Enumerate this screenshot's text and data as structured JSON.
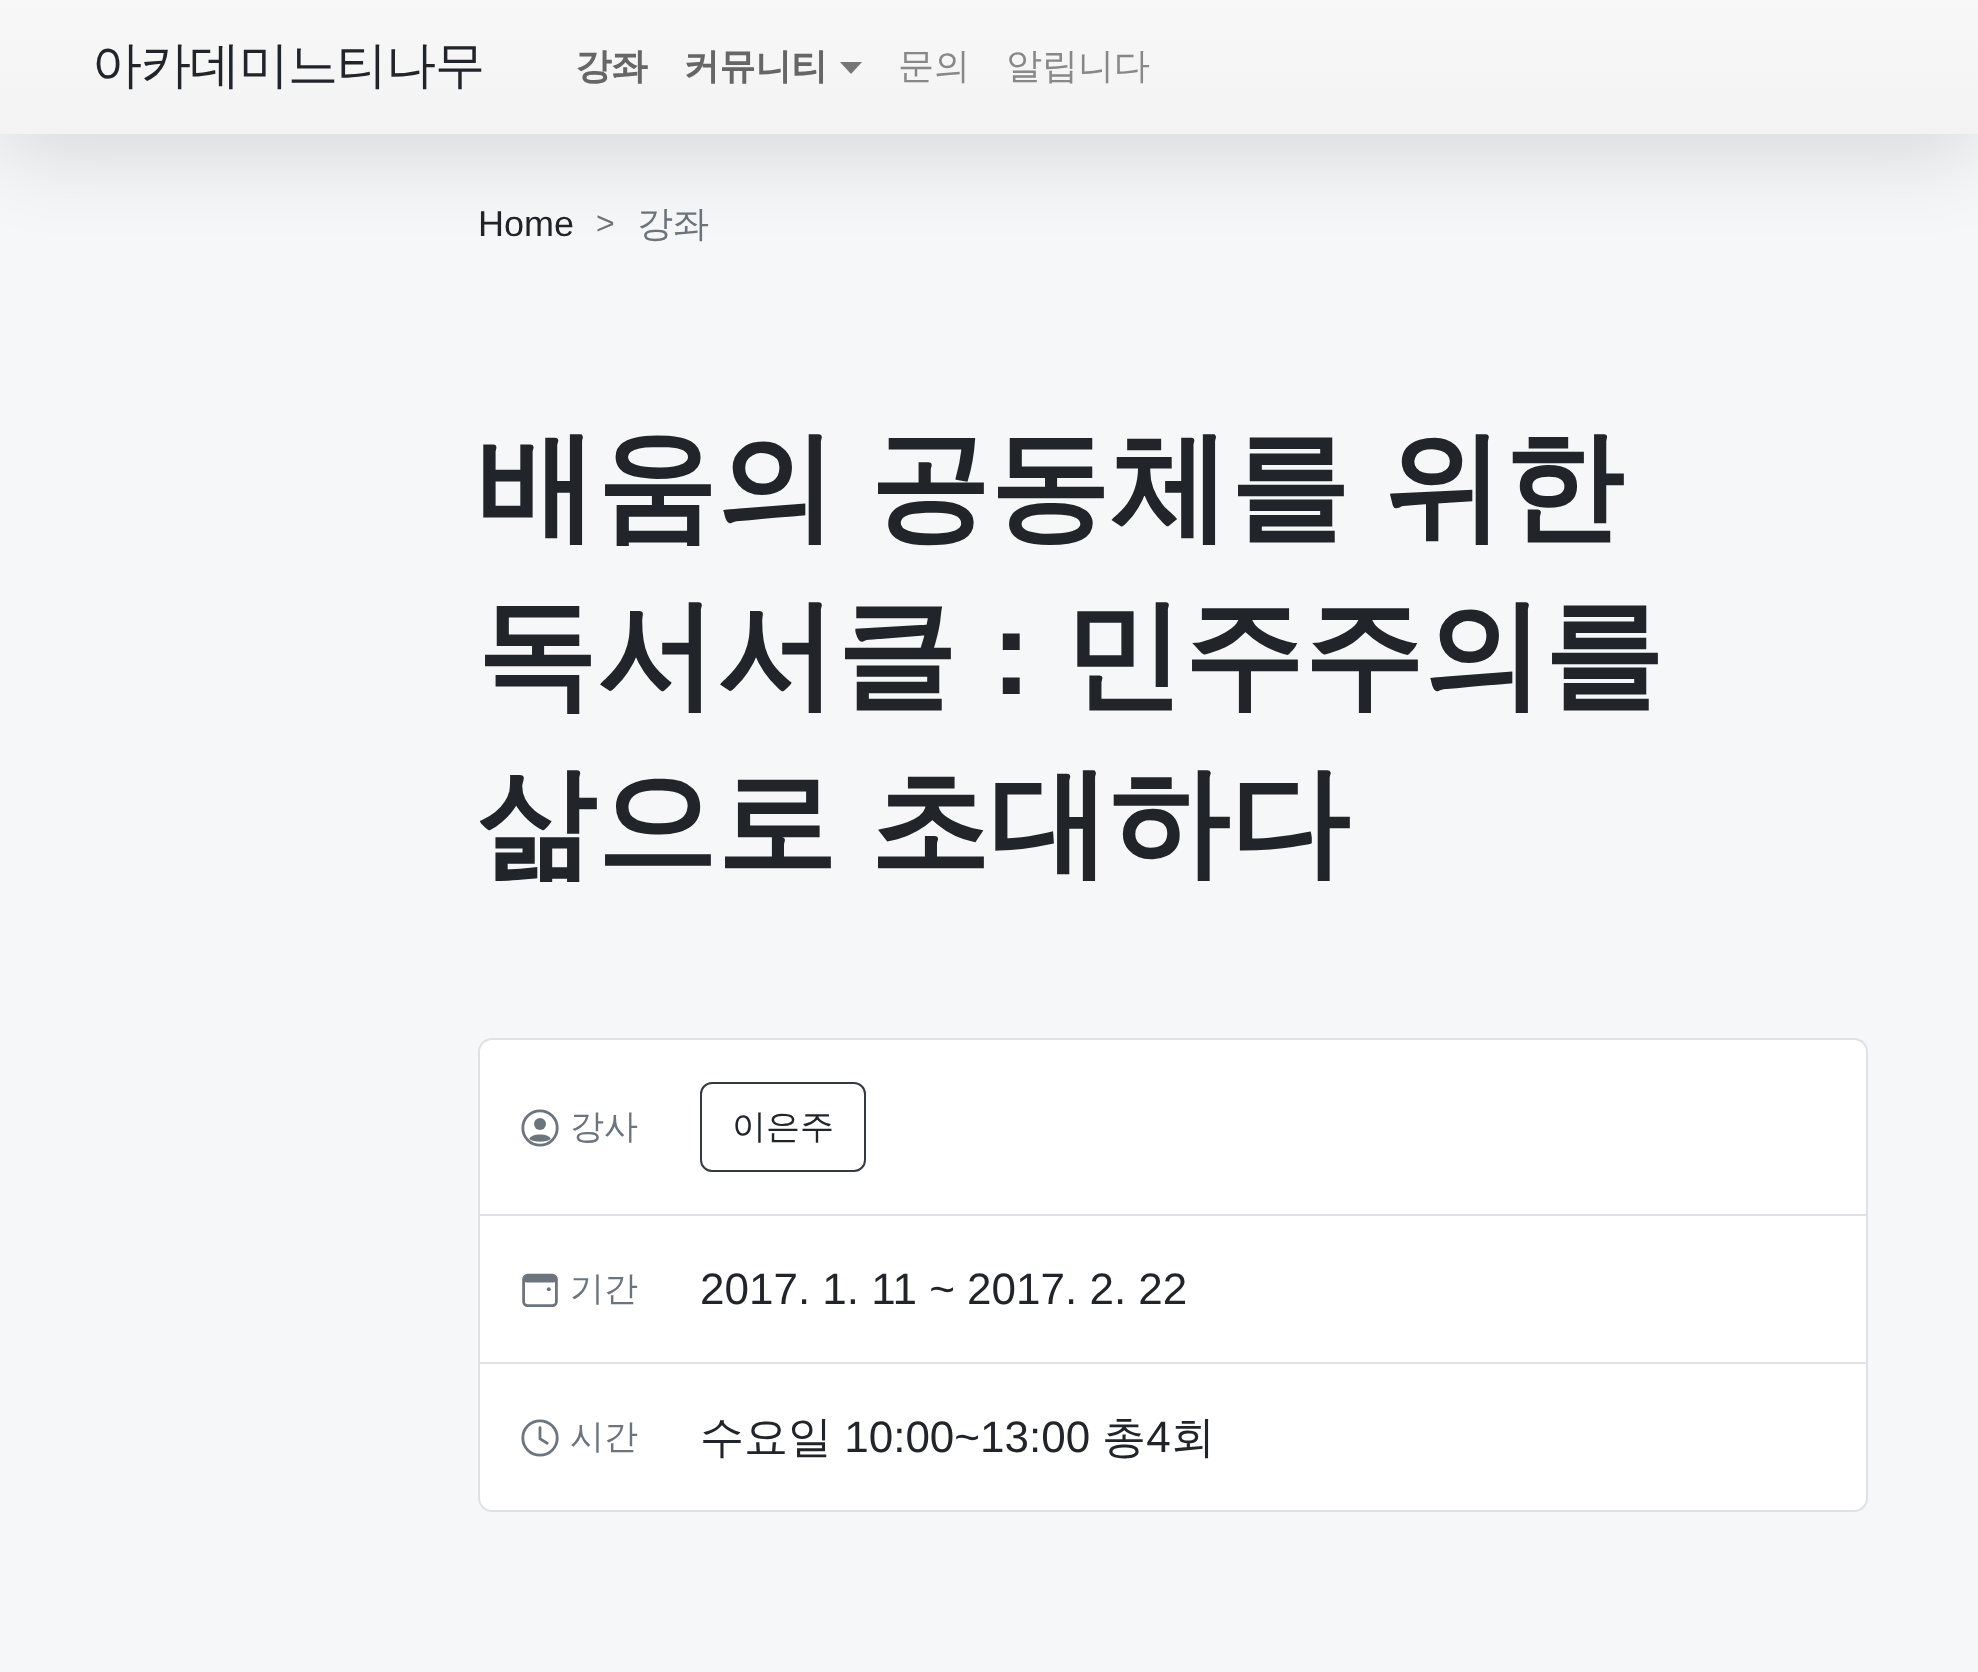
{
  "navbar": {
    "brand": "아카데미느티나무",
    "items": [
      {
        "label": "강좌",
        "kind": "link",
        "selected": true
      },
      {
        "label": "커뮤니티",
        "kind": "dropdown",
        "selected": true
      },
      {
        "label": "문의",
        "kind": "link",
        "selected": false
      },
      {
        "label": "알립니다",
        "kind": "link",
        "selected": false
      }
    ]
  },
  "breadcrumb": {
    "separator": ">",
    "items": [
      {
        "label": "Home",
        "selected": false
      },
      {
        "label": "강좌",
        "selected": true
      }
    ]
  },
  "title": "배움의 공동체를 위한 독서서클 : 민주주의를 삶으로 초대하다",
  "details": [
    {
      "kind": "instructor",
      "label": "강사",
      "value": "이은주"
    },
    {
      "kind": "period",
      "label": "기간",
      "value": "2017. 1. 11 ~ 2017. 2. 22"
    },
    {
      "kind": "time",
      "label": "시간",
      "value": "수요일 10:00~13:00 총4회"
    }
  ]
}
